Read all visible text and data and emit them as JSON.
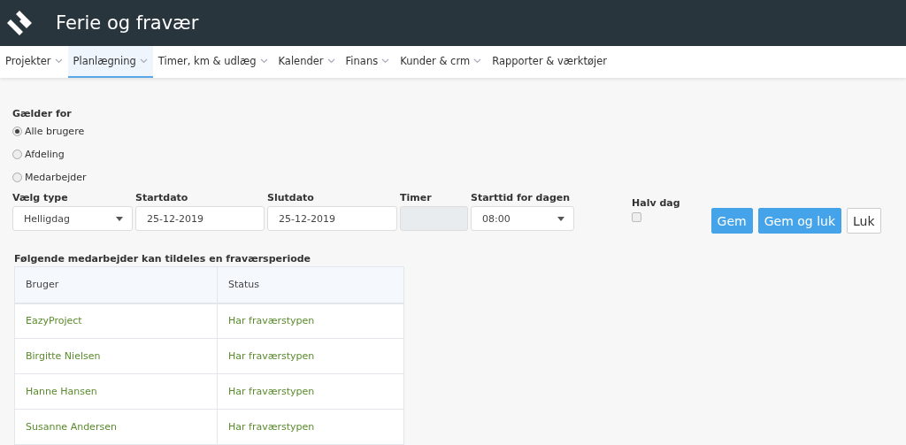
{
  "header": {
    "title": "Ferie og fravær"
  },
  "nav": [
    {
      "label": "Projekter",
      "selected": false,
      "has_menu": true
    },
    {
      "label": "Planlægning",
      "selected": true,
      "has_menu": true
    },
    {
      "label": "Timer, km & udlæg",
      "selected": false,
      "has_menu": true
    },
    {
      "label": "Kalender",
      "selected": false,
      "has_menu": true
    },
    {
      "label": "Finans",
      "selected": false,
      "has_menu": true
    },
    {
      "label": "Kunder & crm",
      "selected": false,
      "has_menu": true
    },
    {
      "label": "Rapporter & værktøjer",
      "selected": false,
      "has_menu": false
    }
  ],
  "applies_to": {
    "label": "Gælder for",
    "options": [
      {
        "label": "Alle brugere",
        "selected": true
      },
      {
        "label": "Afdeling",
        "selected": false
      },
      {
        "label": "Medarbejder",
        "selected": false
      }
    ]
  },
  "fields": [
    {
      "kind": "select",
      "label": "Vælg type",
      "value": "Helligdag"
    },
    {
      "kind": "text",
      "label": "Startdato",
      "value": "25-12-2019"
    },
    {
      "kind": "text",
      "label": "Slutdato",
      "value": "25-12-2019"
    },
    {
      "kind": "disabled",
      "label": "Timer"
    },
    {
      "kind": "select",
      "label": "Starttid for dagen",
      "value": "08:00"
    }
  ],
  "half_day": {
    "label": "Halv dag",
    "checked": false
  },
  "buttons": [
    {
      "label": "Gem",
      "kind": "primary"
    },
    {
      "label": "Gem og luk",
      "kind": "primary"
    },
    {
      "label": "Luk",
      "kind": "default"
    }
  ],
  "table": {
    "title": "Følgende medarbejder kan tildeles en fraværsperiode",
    "columns": [
      "Bruger",
      "Status"
    ],
    "rows": [
      [
        "EazyProject",
        "Har fraværstypen"
      ],
      [
        "Birgitte Nielsen",
        "Har fraværstypen"
      ],
      [
        "Hanne Hansen",
        "Har fraværstypen"
      ],
      [
        "Susanne Andersen",
        "Har fraværstypen"
      ]
    ]
  }
}
